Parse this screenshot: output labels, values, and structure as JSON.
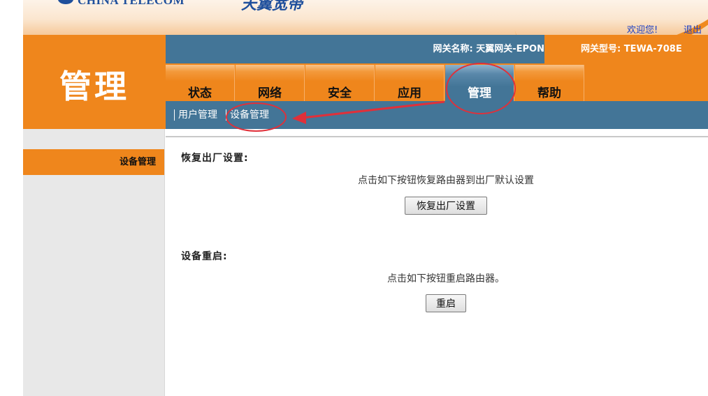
{
  "header": {
    "logo_text": "CHINA TELECOM",
    "brand_text": "天翼宽带",
    "welcome": "欢迎您!",
    "logout": "退出"
  },
  "page_title": "管理",
  "info_bar": {
    "gateway_name": "网关名称:  天翼网关-EPON",
    "gateway_model": "网关型号: TEWA-708E"
  },
  "tabs": [
    {
      "label": "状态"
    },
    {
      "label": "网络"
    },
    {
      "label": "安全"
    },
    {
      "label": "应用"
    },
    {
      "label": "管理",
      "active": true
    },
    {
      "label": "帮助"
    }
  ],
  "subnav": [
    {
      "label": "用户管理"
    },
    {
      "label": "设备管理",
      "active": true
    }
  ],
  "sidebar": {
    "active_item": "设备管理"
  },
  "main": {
    "restore": {
      "title": "恢复出厂设置:",
      "description": "点击如下按钮恢复路由器到出厂默认设置",
      "button": "恢复出厂设置"
    },
    "reboot": {
      "title": "设备重启:",
      "description": "点击如下按钮重启路由器。",
      "button": "重启"
    }
  },
  "colors": {
    "orange": "#ef861c",
    "steel_blue": "#437597",
    "annotation_red": "#e0303a",
    "link_blue": "#1a3fc4"
  }
}
